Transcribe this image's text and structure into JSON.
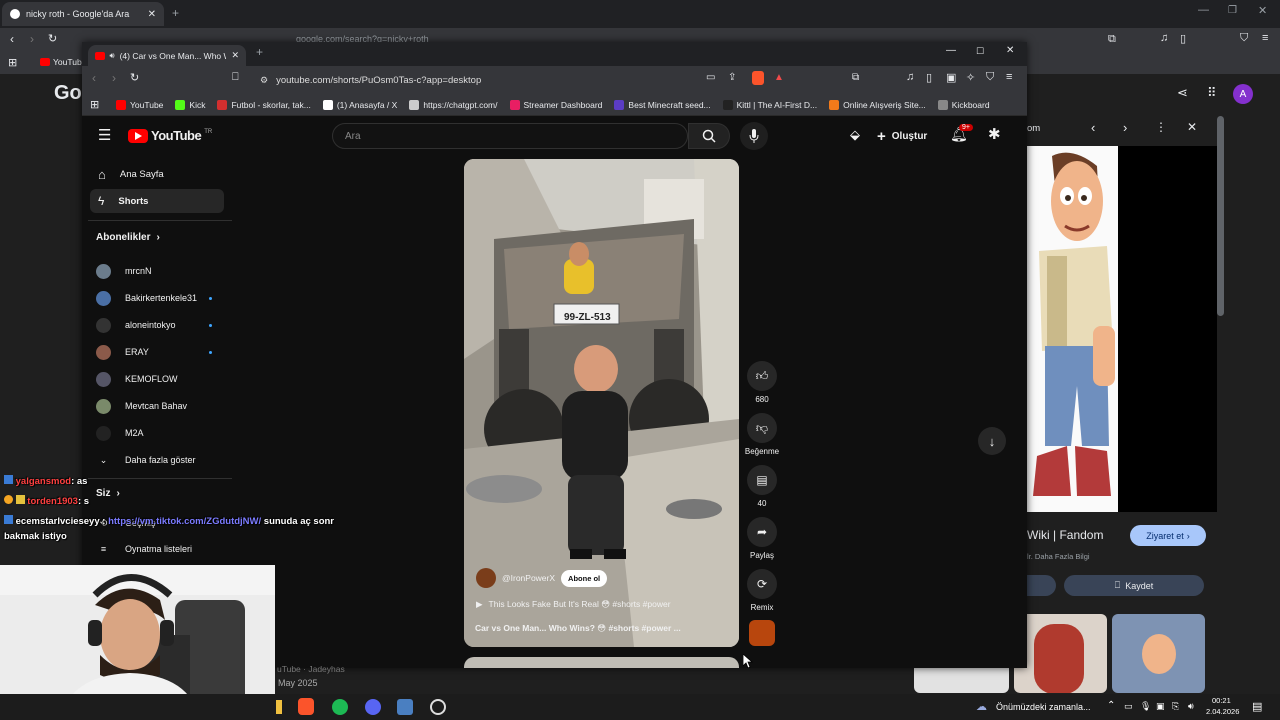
{
  "back_browser": {
    "tab_title": "nicky roth - Google'da Ara",
    "address": "google.com/search?q=nicky+roth",
    "bookmark_first": "YouTub",
    "google_logo_partial": "Go",
    "avatar_letter": "A"
  },
  "inner_browser": {
    "tab_title": "(4) Car vs One Man... Who W",
    "url": "youtube.com/shorts/PuOsm0Tas-c?app=desktop",
    "bookmarks": [
      {
        "label": "YouTube",
        "color": "#ff0000"
      },
      {
        "label": "Kick",
        "color": "#53fc18"
      },
      {
        "label": "Futbol - skorlar, tak...",
        "color": "#d32f2f"
      },
      {
        "label": "(1) Anasayfa / X",
        "color": "#ffffff"
      },
      {
        "label": "https://chatgpt.com/",
        "color": "#cccccc"
      },
      {
        "label": "Streamer Dashboard",
        "color": "#e91e63"
      },
      {
        "label": "Best Minecraft seed...",
        "color": "#5b3cc4"
      },
      {
        "label": "Kittl | The AI-First D...",
        "color": "#222222"
      },
      {
        "label": "Online Alışveriş Site...",
        "color": "#f27a1a"
      },
      {
        "label": "Kickboard",
        "color": "#888888"
      }
    ]
  },
  "youtube": {
    "logo_text": "YouTube",
    "logo_region": "TR",
    "search_placeholder": "Ara",
    "create_label": "Oluştur",
    "notification_count": "9+",
    "sidebar": {
      "home": "Ana Sayfa",
      "shorts": "Shorts",
      "subscriptions_title": "Abonelikler",
      "subscriptions": [
        {
          "name": "mrcnN",
          "color": "#6b7c8c",
          "live": false
        },
        {
          "name": "Bakirkertenkele31",
          "color": "#4a6fa5",
          "live": true
        },
        {
          "name": "aloneintokyo",
          "color": "#333333",
          "live": true
        },
        {
          "name": "ERAY",
          "color": "#8b5a4a",
          "live": true
        },
        {
          "name": "KEMOFLOW",
          "color": "#555566",
          "live": false
        },
        {
          "name": "Mevtcan Bahav",
          "color": "#7a8a6a",
          "live": false
        },
        {
          "name": "M2A",
          "color": "#222222",
          "live": false
        }
      ],
      "show_more": "Daha fazla göster",
      "you_title": "Siz",
      "history": "Geçmiş",
      "playlists": "Oynatma listeleri"
    },
    "short": {
      "channel": "@IronPowerX",
      "subscribe_label": "Abone ol",
      "playlist_title": "This Looks Fake But It's Real 😳 #shorts #power",
      "title": "Car vs One Man... Who Wins? 😳 #shorts #power ...",
      "plate": "99-ZL-513"
    },
    "actions": {
      "likes": "680",
      "dislike_label": "Beğenme",
      "comments": "40",
      "share_label": "Paylaş",
      "remix_label": "Remix"
    },
    "below_channel": "uTube · Jadeyhas",
    "below_date": "May 2025"
  },
  "google_panel": {
    "header_partial": "om",
    "result_title": "Wiki | Fandom",
    "result_sub": "lr. Daha Fazla Bilgi",
    "visit_label": "Ziyaret et",
    "save_label": "Kaydet"
  },
  "chat": [
    {
      "user": "yalgansmod",
      "message": ": as",
      "color": "#ff4040"
    },
    {
      "user": "torden1903",
      "message": ": s",
      "color": "#ff4040"
    },
    {
      "user": "ecemstarlvcieseyy",
      "link": "https://vm.tiktok.com/ZGdutdjNW/",
      "message": " sunuda aç sonr",
      "color": "#ffffff"
    },
    {
      "user": "",
      "message": "bakmak istiyo",
      "color": "#ffffff"
    }
  ],
  "taskbar": {
    "weather_text": "Önümüzdeki zamanla...",
    "time": "00:21",
    "date": "2.04.2026"
  }
}
